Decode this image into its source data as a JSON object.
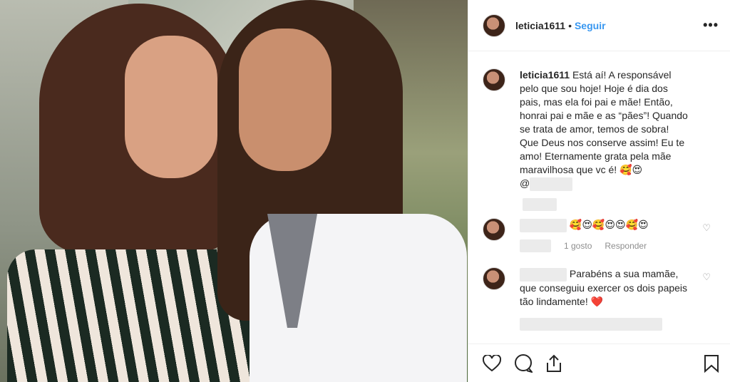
{
  "post": {
    "username": "leticia1611",
    "separator": "•",
    "follow_label": "Seguir",
    "more_label": "•••"
  },
  "caption": {
    "username": "leticia1611",
    "text": "Está aí! A responsável pelo que sou hoje! Hoje é dia dos pais, mas ela foi pai e mãe! Então, honrai pai e mãe e as “pães”! Quando se trata de amor, temos de sobra! Que Deus nos conserve assim! Eu te amo! Eternamente grata pela mãe maravilhosa que vc é! 🥰😍",
    "mention_prefix": "@"
  },
  "comments": [
    {
      "emojis": "🥰😍🥰😍😍🥰😍",
      "likes": "1 gosto",
      "reply_label": "Responder"
    },
    {
      "text": "Parabéns a sua mamãe, que conseguiu exercer os dois papeis tão lindamente! ❤️"
    }
  ],
  "actions": {
    "like_icon": "heart-outline-icon",
    "comment_icon": "speech-bubble-icon",
    "share_icon": "share-upload-icon",
    "save_icon": "bookmark-icon"
  },
  "colors": {
    "link_blue": "#3897f0",
    "muted": "#8e8e8e",
    "text": "#262626",
    "border": "#efefef"
  }
}
